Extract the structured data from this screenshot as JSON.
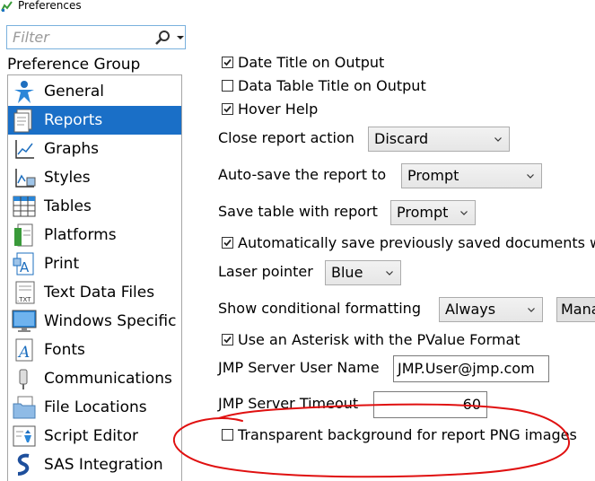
{
  "window": {
    "title": "Preferences"
  },
  "filter": {
    "placeholder": "Filter"
  },
  "sidebar": {
    "heading": "Preference Group",
    "items": [
      {
        "label": "General",
        "icon": "general-person-icon"
      },
      {
        "label": "Reports",
        "icon": "report-document-icon",
        "selected": true
      },
      {
        "label": "Graphs",
        "icon": "line-graph-icon"
      },
      {
        "label": "Styles",
        "icon": "styles-graph-icon"
      },
      {
        "label": "Tables",
        "icon": "table-grid-icon"
      },
      {
        "label": "Platforms",
        "icon": "platforms-icon"
      },
      {
        "label": "Print",
        "icon": "print-icon"
      },
      {
        "label": "Text Data Files",
        "icon": "text-file-icon"
      },
      {
        "label": "Windows Specific",
        "icon": "monitor-icon"
      },
      {
        "label": "Fonts",
        "icon": "font-icon"
      },
      {
        "label": "Communications",
        "icon": "communications-icon"
      },
      {
        "label": "File Locations",
        "icon": "folder-icon"
      },
      {
        "label": "Script Editor",
        "icon": "script-editor-icon"
      },
      {
        "label": "SAS Integration",
        "icon": "sas-icon"
      }
    ]
  },
  "reports": {
    "date_title": {
      "label": "Date Title on Output",
      "checked": true
    },
    "data_table_title": {
      "label": "Data Table Title on Output",
      "checked": false
    },
    "hover_help": {
      "label": "Hover Help",
      "checked": true
    },
    "close_report_action": {
      "label": "Close report action",
      "value": "Discard"
    },
    "auto_save": {
      "label": "Auto-save the report to",
      "value": "Prompt"
    },
    "save_table": {
      "label": "Save table with report",
      "value": "Prompt"
    },
    "auto_save_docs": {
      "label": "Automatically save previously saved documents whe",
      "checked": true
    },
    "laser_pointer": {
      "label": "Laser pointer",
      "value": "Blue"
    },
    "conditional_formatting": {
      "label": "Show conditional formatting",
      "value": "Always",
      "button": "Mana"
    },
    "asterisk_pvalue": {
      "label": "Use an Asterisk with the PValue Format",
      "checked": true
    },
    "jmp_server_user": {
      "label": "JMP Server User Name",
      "value": "JMP.User@jmp.com"
    },
    "jmp_server_timeout": {
      "label": "JMP Server Timeout",
      "value": "60"
    },
    "transparent_png": {
      "label": "Transparent background for report PNG images",
      "checked": false
    }
  },
  "colors": {
    "selection": "#1a6fc7",
    "annotation": "#e01010"
  }
}
